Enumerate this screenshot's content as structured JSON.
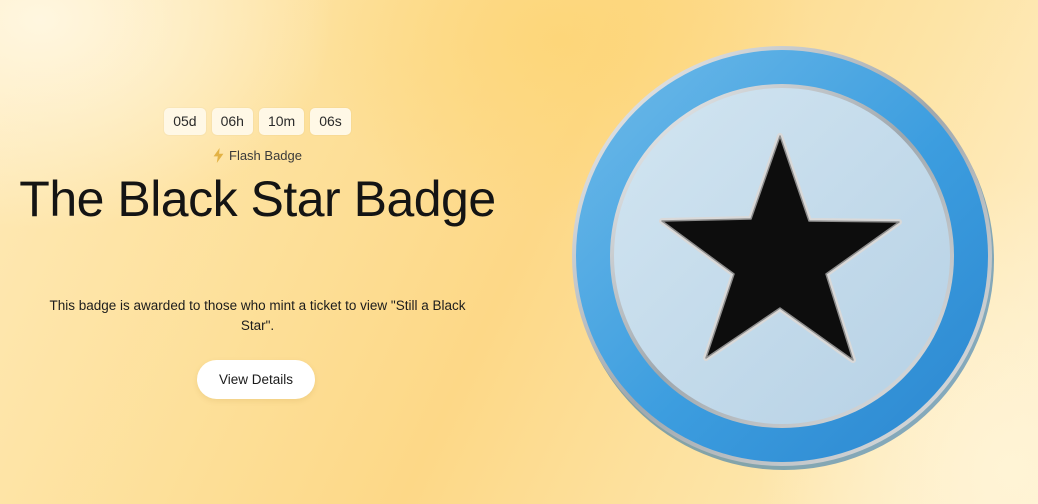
{
  "countdown": {
    "days": "05d",
    "hours": "06h",
    "minutes": "10m",
    "seconds": "06s"
  },
  "badge_type": {
    "icon": "lightning-bolt-icon",
    "label": "Flash Badge"
  },
  "title": "The Black Star Badge",
  "description": "This badge is awarded to those who mint a ticket to view \"Still a Black Star\".",
  "cta": {
    "label": "View Details"
  },
  "badge_image": {
    "icon": "black-star-badge",
    "outer_ring_color": "#3a9fe0",
    "inner_face_color": "#c3daea",
    "star_color": "#0d0d0d",
    "rim_color": "#c8c8c8"
  }
}
